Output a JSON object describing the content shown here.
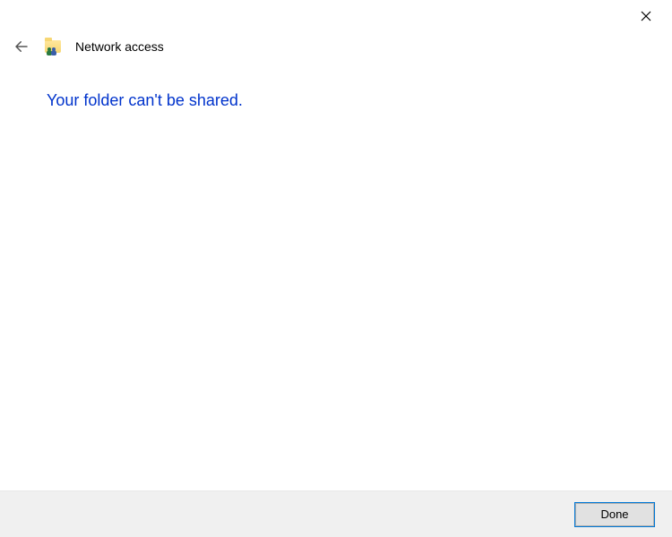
{
  "titlebar": {
    "close_label": "Close"
  },
  "header": {
    "back_label": "Back",
    "icon_name": "network-share-folder",
    "title": "Network access"
  },
  "content": {
    "message": "Your folder can't be shared."
  },
  "footer": {
    "done_label": "Done"
  }
}
